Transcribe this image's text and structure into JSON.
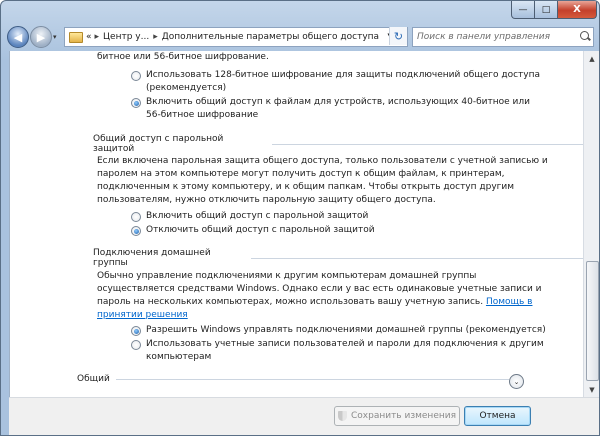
{
  "window": {
    "controls": {
      "minimize": "—",
      "maximize": "□",
      "close": "X"
    }
  },
  "nav": {
    "back_glyph": "◀",
    "forward_glyph": "▶",
    "history_glyph": "▾",
    "address": {
      "crumbs": [
        "«",
        "Центр у...",
        "Дополнительные параметры общего доступа"
      ],
      "separator": "▸",
      "dropdown_glyph": "▾",
      "refresh_glyph": "↻"
    },
    "search": {
      "placeholder": "Поиск в панели управления"
    }
  },
  "encryption": {
    "partial_top": "битное или 56-битное шифрование.",
    "options": [
      {
        "lines": [
          "Использовать 128-битное шифрование для защиты подключений общего доступа",
          "(рекомендуется)"
        ],
        "checked": false
      },
      {
        "lines": [
          "Включить общий доступ к файлам для устройств, использующих 40-битное или",
          "56-битное шифрование"
        ],
        "checked": true
      }
    ]
  },
  "password": {
    "heading": "Общий доступ с парольной защитой",
    "description": [
      "Если включена парольная защита общего доступа, только пользователи с учетной записью и",
      "паролем на этом компьютере могут получить доступ к общим файлам, к принтерам,",
      "подключенным к этому компьютеру, и к общим папкам. Чтобы открыть доступ другим",
      "пользователям, нужно отключить парольную защиту общего доступа."
    ],
    "options": [
      {
        "label": "Включить общий доступ с парольной защитой",
        "checked": false
      },
      {
        "label": "Отключить общий доступ с парольной защитой",
        "checked": true
      }
    ]
  },
  "homegroup": {
    "heading": "Подключения домашней группы",
    "description": [
      "Обычно управление подключениями к другим компьютерам домашней группы",
      "осуществляется средствами Windows. Однако если у вас есть одинаковые учетные записи и",
      "пароль на нескольких компьютерах, можно использовать вашу учетную запись."
    ],
    "help_link_part1": "Помощь в",
    "help_link_part2": "принятии решения",
    "options": [
      {
        "lines": [
          "Разрешить Windows управлять подключениями домашней группы (рекомендуется)"
        ],
        "checked": true
      },
      {
        "lines": [
          "Использовать учетные записи пользователей и пароли для подключения к другим",
          "компьютерам"
        ],
        "checked": false
      }
    ]
  },
  "general": {
    "heading": "Общий",
    "expand_glyph": "⌄"
  },
  "scroll": {
    "up_glyph": "▲",
    "down_glyph": "▼"
  },
  "footer": {
    "save_label": "Сохранить изменения",
    "cancel_label": "Отмена"
  }
}
